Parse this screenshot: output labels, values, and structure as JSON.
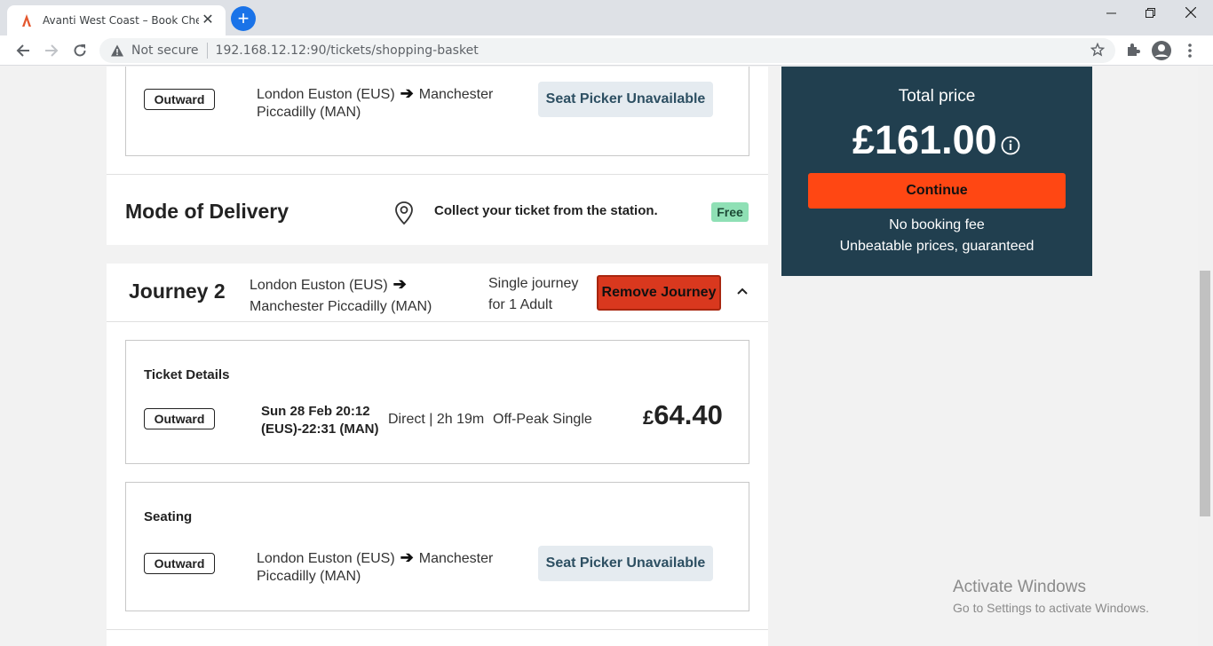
{
  "browser": {
    "tab_title": "Avanti West Coast – Book Cheap",
    "security_label": "Not secure",
    "url": "192.168.12.12:90/tickets/shopping-basket"
  },
  "journey1_seating": {
    "outward_label": "Outward",
    "route_from": "London Euston (EUS)",
    "route_to": "Manchester",
    "route_to_line2": "Piccadilly (MAN)",
    "seat_button": "Seat Picker Unavailable"
  },
  "delivery": {
    "title": "Mode of Delivery",
    "text": "Collect your ticket from the station.",
    "badge": "Free"
  },
  "journey2": {
    "title": "Journey 2",
    "from": "London Euston (EUS)",
    "to": "Manchester Piccadilly (MAN)",
    "journey_type": "Single journey",
    "passengers": "for 1 Adult",
    "remove_label": "Remove Journey",
    "ticket_details": {
      "title": "Ticket Details",
      "outward_label": "Outward",
      "datetime": "Sun 28 Feb 20:12",
      "times": "(EUS)-22:31 (MAN)",
      "direct": "Direct | 2h 19m",
      "fare_type": "Off-Peak Single",
      "currency": "£",
      "price": "64.40"
    },
    "seating": {
      "title": "Seating",
      "outward_label": "Outward",
      "route_from": "London Euston (EUS)",
      "route_to": "Manchester",
      "route_to_line2": "Piccadilly (MAN)",
      "seat_button": "Seat Picker Unavailable"
    }
  },
  "summary": {
    "total_label": "Total price",
    "total_price": "£161.00",
    "continue_label": "Continue",
    "fee_note": "No booking fee",
    "guarantee": "Unbeatable prices, guaranteed"
  },
  "watermark": {
    "title": "Activate Windows",
    "subtitle": "Go to Settings to activate Windows."
  },
  "colors": {
    "brand_orange": "#ff4713",
    "panel_navy": "#213f4f",
    "remove_red": "#d9381e",
    "free_badge": "#8fe0b5"
  }
}
